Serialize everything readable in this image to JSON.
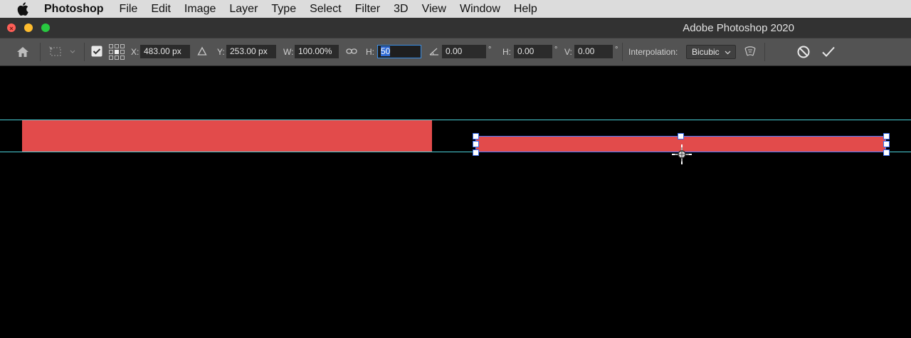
{
  "menubar": {
    "app_name": "Photoshop",
    "items": [
      "File",
      "Edit",
      "Image",
      "Layer",
      "Type",
      "Select",
      "Filter",
      "3D",
      "View",
      "Window",
      "Help"
    ]
  },
  "window": {
    "title": "Adobe Photoshop 2020"
  },
  "options": {
    "x_label": "X:",
    "x_value": "483.00 px",
    "y_label": "Y:",
    "y_value": "253.00 px",
    "w_label": "W:",
    "w_value": "100.00%",
    "h_label": "H:",
    "h_value": "50",
    "rotate_value": "0.00",
    "degree_symbol": "°",
    "skew_h_label": "H:",
    "skew_h_value": "0.00",
    "skew_v_label": "V:",
    "skew_v_value": "0.00",
    "interpolation_label": "Interpolation:",
    "interpolation_value": "Bicubic"
  },
  "colors": {
    "shape_fill": "#e24b4b",
    "guide": "#4ad0d8",
    "selection": "#4a7cff"
  }
}
